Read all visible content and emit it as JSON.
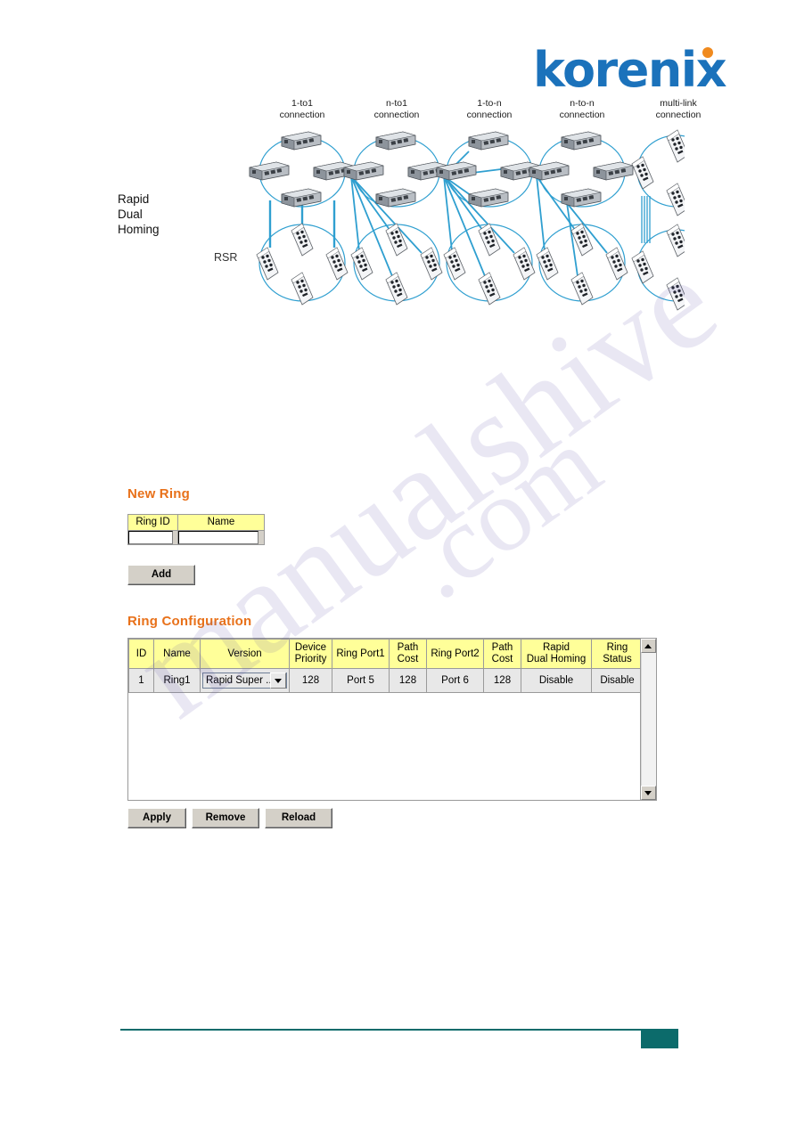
{
  "brand": {
    "logo_text": "korenix",
    "logo_color": "#1b72bb",
    "logo_dot_color": "#f08a1e"
  },
  "diagram": {
    "side_label": "Rapid\nDual\nHoming",
    "side_label_lines": [
      "Rapid",
      "Dual",
      "Homing"
    ],
    "ring_center_label": "RSR",
    "columns": [
      {
        "line1": "1-to1",
        "line2": "connection"
      },
      {
        "line1": "n-to1",
        "line2": "connection"
      },
      {
        "line1": "1-to-n",
        "line2": "connection"
      },
      {
        "line1": "n-to-n",
        "line2": "connection"
      },
      {
        "line1": "multi-link",
        "line2": "connection"
      }
    ]
  },
  "new_ring": {
    "heading": "New Ring",
    "heading_color": "#e8711a",
    "columns": [
      "Ring ID",
      "Name"
    ],
    "values": {
      "ring_id": "",
      "name": ""
    },
    "add_label": "Add"
  },
  "ring_configuration": {
    "heading": "Ring Configuration",
    "heading_color": "#e8711a",
    "columns": [
      "ID",
      "Name",
      "Version",
      "Device Priority",
      "Ring Port1",
      "Path Cost",
      "Ring Port2",
      "Path Cost",
      "Rapid Dual Homing",
      "Ring Status"
    ],
    "column_lines": [
      [
        "ID"
      ],
      [
        "Name"
      ],
      [
        "Version"
      ],
      [
        "Device",
        "Priority"
      ],
      [
        "Ring Port1"
      ],
      [
        "Path",
        "Cost"
      ],
      [
        "Ring Port2"
      ],
      [
        "Path",
        "Cost"
      ],
      [
        "Rapid",
        "Dual Homing"
      ],
      [
        "Ring",
        "Status"
      ]
    ],
    "rows": [
      {
        "id": "1",
        "name": "Ring1",
        "version": "Rapid Super ...",
        "device_priority": "128",
        "ring_port1": "Port 5",
        "path_cost1": "128",
        "ring_port2": "Port 6",
        "path_cost2": "128",
        "rapid_dual_homing": "Disable",
        "ring_status": "Disable"
      }
    ],
    "buttons": {
      "apply": "Apply",
      "remove": "Remove",
      "reload": "Reload"
    }
  },
  "footer": {
    "page_number": "",
    "rule_color": "#0c6b6b"
  },
  "watermark": {
    "line_a": "manualshive",
    "line_b": ".com"
  },
  "theme": {
    "header_yellow": "#ffff99",
    "cell_gray": "#e8e8e8",
    "button_face": "#d4d0c8",
    "link_blue": "#2f9fd0"
  }
}
